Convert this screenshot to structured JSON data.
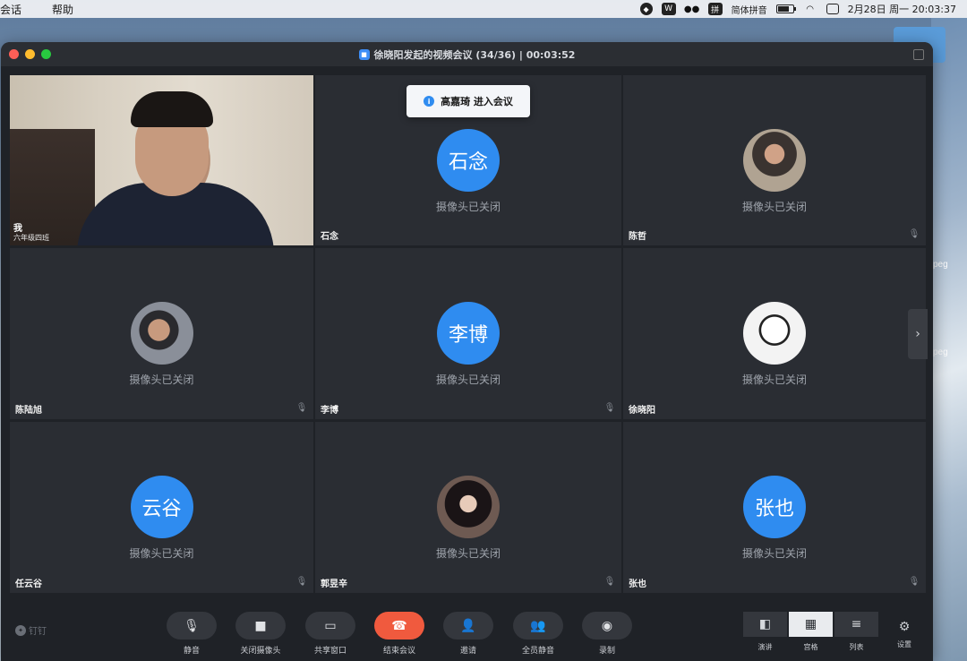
{
  "menubar": {
    "items": [
      "会话",
      "帮助"
    ],
    "input_method": "简体拼音",
    "input_icon": "拼",
    "datetime": "2月28日 周一  20:03:37"
  },
  "desktop": {
    "file1": "peg",
    "file2": "peg"
  },
  "window": {
    "title": "徐晓阳发起的视频会议 (34/36) | 00:03:52"
  },
  "toast": {
    "message": "高嘉琦 进入会议"
  },
  "self_tile": {
    "name": "我",
    "subtitle": "六年级四班"
  },
  "camera_off_text": "摄像头已关闭",
  "participants": [
    {
      "name": "石念",
      "avatar_text": "石念"
    },
    {
      "name": "陈哲",
      "avatar_text": ""
    },
    {
      "name": "陈陆旭",
      "avatar_text": ""
    },
    {
      "name": "李博",
      "avatar_text": "李博"
    },
    {
      "name": "徐晓阳",
      "avatar_text": ""
    },
    {
      "name": "任云谷",
      "avatar_text": "云谷"
    },
    {
      "name": "郭昱辛",
      "avatar_text": ""
    },
    {
      "name": "张也",
      "avatar_text": "张也"
    }
  ],
  "toolbar": {
    "brand": "钉钉",
    "mute": "静音",
    "camera": "关闭摄像头",
    "share": "共享窗口",
    "end": "结束会议",
    "invite": "邀请",
    "mute_all": "全员静音",
    "record": "录制",
    "view_speaker": "演讲",
    "view_grid": "宫格",
    "view_list": "列表",
    "settings": "设置"
  },
  "colors": {
    "accent": "#2f8cf0",
    "end_call": "#f05a3e",
    "window_bg": "#1f2227",
    "tile_bg": "#2a2d33"
  }
}
